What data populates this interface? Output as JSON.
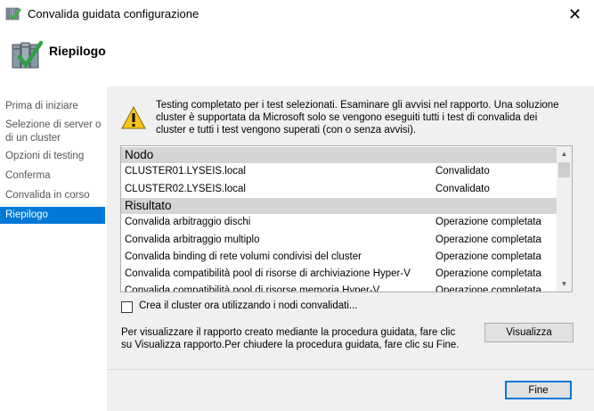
{
  "window": {
    "title": "Convalida guidata configurazione"
  },
  "header": {
    "title": "Riepilogo"
  },
  "nav": {
    "items": [
      {
        "label": "Prima di iniziare"
      },
      {
        "label": "Selezione di server o di un cluster"
      },
      {
        "label": "Opzioni di testing"
      },
      {
        "label": "Conferma"
      },
      {
        "label": "Convalida in corso"
      },
      {
        "label": "Riepilogo",
        "active": true
      }
    ]
  },
  "info": {
    "text": "Testing completato per i test selezionati. Esaminare gli avvisi nel rapporto.  Una soluzione cluster è supportata da Microsoft solo se vengono eseguiti tutti i test di convalida dei cluster e tutti i test vengono superati (con o senza avvisi)."
  },
  "list": {
    "node_header": "Nodo",
    "nodes": [
      {
        "name": "CLUSTER01.LYSEIS.local",
        "status": "Convalidato"
      },
      {
        "name": "CLUSTER02.LYSEIS.local",
        "status": "Convalidato"
      }
    ],
    "result_header": "Risultato",
    "results": [
      {
        "name": "Convalida arbitraggio dischi",
        "status": "Operazione completata"
      },
      {
        "name": "Convalida arbitraggio multiplo",
        "status": "Operazione completata"
      },
      {
        "name": "Convalida binding di rete volumi condivisi del cluster",
        "status": "Operazione completata"
      },
      {
        "name": "Convalida compatibilità pool di risorse di archiviazione Hyper-V",
        "status": "Operazione completata"
      },
      {
        "name": "Convalida compatibilità pool di risorse memoria Hyper-V",
        "status": "Operazione completata"
      }
    ]
  },
  "checkbox": {
    "label": "Crea il cluster ora utilizzando i nodi convalidati...",
    "checked": false
  },
  "report": {
    "text": "Per visualizzare il rapporto creato mediante la procedura guidata, fare clic su Visualizza rapporto.Per chiudere la procedura guidata, fare clic su Fine."
  },
  "buttons": {
    "view_label": "Visualizza",
    "finish_label": "Fine"
  },
  "colors": {
    "accent": "#0078d7",
    "content_bg": "#f0f0f0",
    "group_header_bg": "#d4d4d4"
  }
}
